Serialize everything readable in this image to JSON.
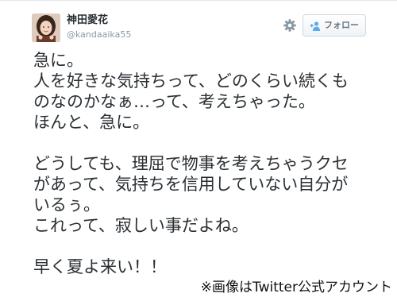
{
  "tweet": {
    "display_name": "神田愛花",
    "screen_name": "@kandaaika55",
    "follow_label": "フォロー",
    "lines": [
      "急に。",
      "人を好きな気持ちって、どのくらい続くも",
      "のなのかなぁ…って、考えちゃった。",
      "ほんと、急に。",
      "",
      "どうしても、理屈で物事を考えちゃうクセ",
      "があって、気持ちを信用していない自分が",
      "いるぅ。",
      "これって、寂しい事だよね。",
      "",
      "早く夏よ来い！！"
    ]
  },
  "caption": "※画像はTwitter公式アカウント",
  "icons": {
    "settings": "gear-icon",
    "follow": "add-user-icon"
  },
  "colors": {
    "name": "#292f33",
    "handle": "#8899a6",
    "button_text": "#66757f",
    "follow_icon": "#55acee",
    "body_text": "#292f33"
  }
}
